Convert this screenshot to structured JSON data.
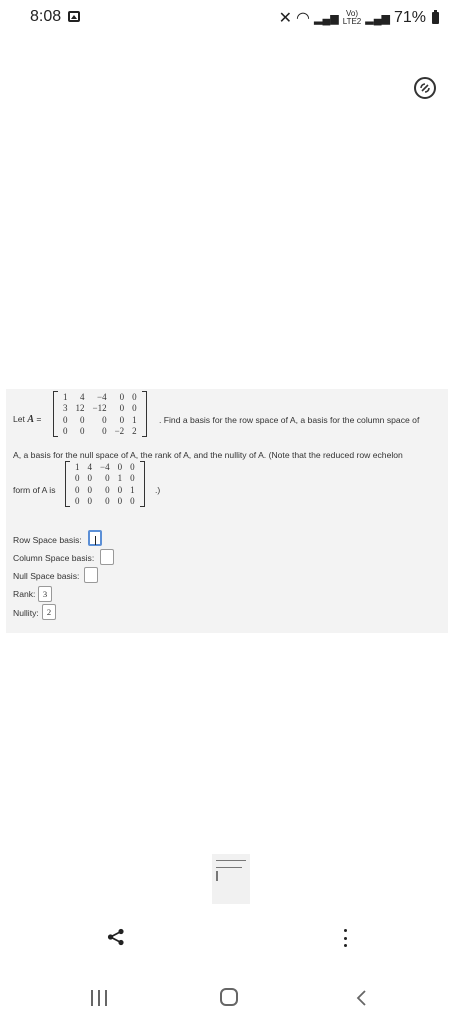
{
  "status_bar": {
    "time": "8:08",
    "signal_label": "Vo)",
    "network": "LTE2",
    "battery": "71%"
  },
  "problem": {
    "let_label": "Let",
    "matrix_name": "A",
    "equals": "=",
    "matrix_A": [
      [
        "1",
        "4",
        "-4",
        "0",
        "0"
      ],
      [
        "3",
        "12",
        "-12",
        "0",
        "0"
      ],
      [
        "0",
        "0",
        "0",
        "0",
        "1"
      ],
      [
        "0",
        "0",
        "0",
        "-2",
        "2"
      ]
    ],
    "prompt_line1": ". Find a basis for the row space of A, a basis for the column space of",
    "prompt_line2": "A, a basis for the null space of A, the rank of A, and the nullity of A. (Note that the reduced row echelon",
    "rref_intro": "form of A is",
    "matrix_rref": [
      [
        "1",
        "4",
        "-4",
        "0",
        "0"
      ],
      [
        "0",
        "0",
        "0",
        "1",
        "0"
      ],
      [
        "0",
        "0",
        "0",
        "0",
        "1"
      ],
      [
        "0",
        "0",
        "0",
        "0",
        "0"
      ]
    ],
    "rref_outro": ".)"
  },
  "fields": {
    "row_space_label": "Row Space basis:",
    "row_space_value": "",
    "column_space_label": "Column Space basis:",
    "column_space_value": "",
    "null_space_label": "Null Space basis:",
    "null_space_value": "",
    "rank_label": "Rank:",
    "rank_value": "3",
    "nullity_label": "Nullity:",
    "nullity_value": "2"
  }
}
